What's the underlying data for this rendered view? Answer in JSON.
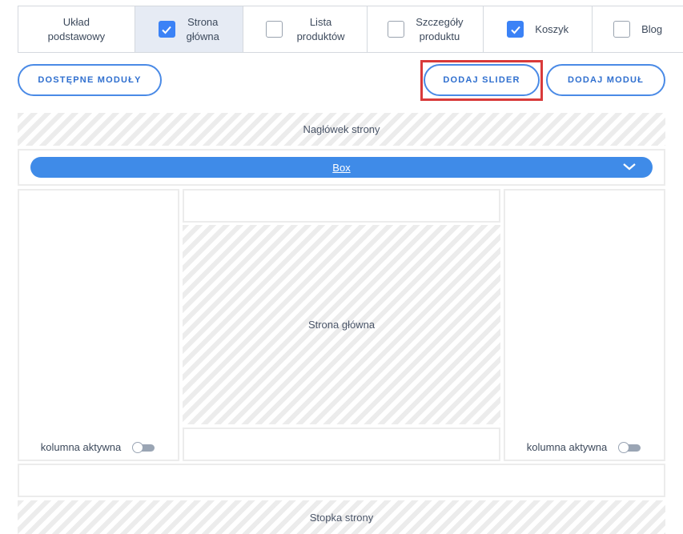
{
  "tabs": [
    {
      "label": "Układ\npodstawowy",
      "checkbox": false,
      "checked": false,
      "selected": false
    },
    {
      "label": "Strona\ngłówna",
      "checkbox": true,
      "checked": true,
      "selected": true
    },
    {
      "label": "Lista\nproduktów",
      "checkbox": true,
      "checked": false,
      "selected": false
    },
    {
      "label": "Szczegóły\nproduktu",
      "checkbox": true,
      "checked": false,
      "selected": false
    },
    {
      "label": "Koszyk",
      "checkbox": true,
      "checked": true,
      "selected": false
    },
    {
      "label": "Blog",
      "checkbox": true,
      "checked": false,
      "selected": false
    }
  ],
  "buttons": {
    "available_modules": "DOSTĘPNE MODUŁY",
    "add_slider": "DODAJ SLIDER",
    "add_module": "DODAJ MODUŁ"
  },
  "layout": {
    "header": "Nagłówek strony",
    "box": "Box",
    "main": "Strona główna",
    "footer": "Stopka strony",
    "left_column_status": "kolumna aktywna",
    "right_column_status": "kolumna aktywna",
    "left_column_active": false,
    "right_column_active": false
  },
  "colors": {
    "accent": "#3f8be8",
    "highlight": "#d93a3a"
  }
}
